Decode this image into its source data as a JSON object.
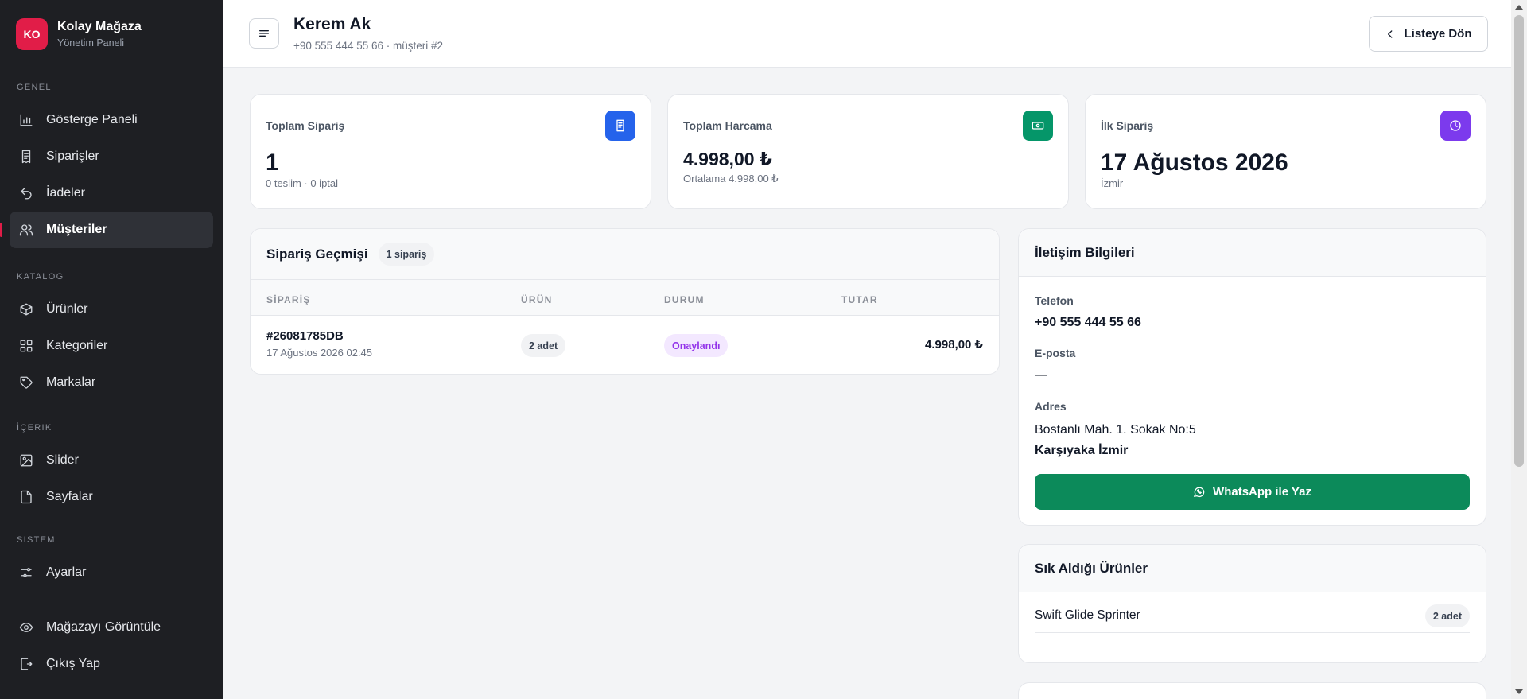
{
  "brand": {
    "logo": "KO",
    "name": "Kolay Mağaza",
    "subtitle": "Yönetim Paneli",
    "accent_color": "#e11d48"
  },
  "sidebar": {
    "sections": [
      {
        "label": "GENEL",
        "items": [
          {
            "label": "Gösterge Paneli",
            "icon": "bar-chart-icon"
          },
          {
            "label": "Siparişler",
            "icon": "receipt-icon"
          },
          {
            "label": "İadeler",
            "icon": "undo-icon"
          },
          {
            "label": "Müşteriler",
            "icon": "users-icon",
            "active": true
          }
        ]
      },
      {
        "label": "KATALOG",
        "items": [
          {
            "label": "Ürünler",
            "icon": "box-icon"
          },
          {
            "label": "Kategoriler",
            "icon": "grid-icon"
          },
          {
            "label": "Markalar",
            "icon": "tag-icon"
          }
        ]
      },
      {
        "label": "İÇERIK",
        "items": [
          {
            "label": "Slider",
            "icon": "image-icon"
          },
          {
            "label": "Sayfalar",
            "icon": "file-icon"
          }
        ]
      },
      {
        "label": "SISTEM",
        "items": [
          {
            "label": "Ayarlar",
            "icon": "sliders-icon"
          }
        ]
      }
    ],
    "footer": [
      {
        "label": "Mağazayı Görüntüle",
        "icon": "eye-icon"
      },
      {
        "label": "Çıkış Yap",
        "icon": "logout-icon"
      }
    ]
  },
  "header": {
    "title": "Kerem Ak",
    "subtitle": "+90 555 444 55 66 · müşteri #2",
    "back_label": "Listeye Dön"
  },
  "stats": [
    {
      "label": "Toplam Sipariş",
      "value": "1",
      "foot": "0 teslim · 0 iptal",
      "icon": "receipt-icon",
      "color": "#2563eb"
    },
    {
      "label": "Toplam Harcama",
      "value": "4.998,00 ₺",
      "foot": "Ortalama 4.998,00 ₺",
      "icon": "banknote-icon",
      "color": "#059669"
    },
    {
      "label": "İlk Sipariş",
      "value": "17 Ağustos 2026",
      "foot": "İzmir",
      "icon": "clock-icon",
      "color": "#7c3aed"
    }
  ],
  "orders": {
    "title": "Sipariş Geçmişi",
    "count_badge": "1 sipariş",
    "columns": [
      "SİPARİŞ",
      "ÜRÜN",
      "DURUM",
      "TUTAR"
    ],
    "rows": [
      {
        "code": "#26081785DB",
        "date": "17 Ağustos 2026 02:45",
        "qty": "2 adet",
        "status": "Onaylandı",
        "amount": "4.998,00 ₺"
      }
    ]
  },
  "contact": {
    "title": "İletişim Bilgileri",
    "phone_label": "Telefon",
    "phone": "+90 555 444 55 66",
    "email_label": "E-posta",
    "email": "—",
    "address_label": "Adres",
    "address_line": "Bostanlı Mah. 1. Sokak No:5",
    "address_city": "Karşıyaka İzmir",
    "whatsapp_label": "WhatsApp ile Yaz",
    "whatsapp_color": "#0c8a5a"
  },
  "frequent": {
    "title": "Sık Aldığı Ürünler",
    "items": [
      {
        "name": "Swift Glide Sprinter",
        "qty": "2 adet"
      }
    ]
  }
}
